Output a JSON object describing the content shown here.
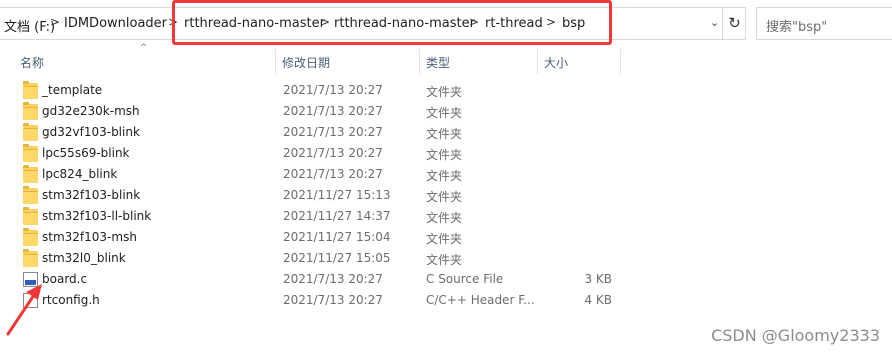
{
  "address": {
    "crumbs": [
      "文档 (F:)",
      "IDMDownloader",
      "rtthread-nano-master",
      "rtthread-nano-master",
      "rt-thread",
      "bsp"
    ],
    "separator": ">"
  },
  "search": {
    "placeholder": "搜索\"bsp\""
  },
  "columns": {
    "name": "名称",
    "date": "修改日期",
    "type": "类型",
    "size": "大小"
  },
  "files": [
    {
      "name": "_template",
      "date": "2021/7/13 20:27",
      "type": "文件夹",
      "size": "",
      "icon": "folder-icon"
    },
    {
      "name": "gd32e230k-msh",
      "date": "2021/7/13 20:27",
      "type": "文件夹",
      "size": "",
      "icon": "folder-icon"
    },
    {
      "name": "gd32vf103-blink",
      "date": "2021/7/13 20:27",
      "type": "文件夹",
      "size": "",
      "icon": "folder-icon"
    },
    {
      "name": "lpc55s69-blink",
      "date": "2021/7/13 20:27",
      "type": "文件夹",
      "size": "",
      "icon": "folder-icon"
    },
    {
      "name": "lpc824_blink",
      "date": "2021/7/13 20:27",
      "type": "文件夹",
      "size": "",
      "icon": "folder-icon"
    },
    {
      "name": "stm32f103-blink",
      "date": "2021/11/27 15:13",
      "type": "文件夹",
      "size": "",
      "icon": "folder-icon"
    },
    {
      "name": "stm32f103-ll-blink",
      "date": "2021/11/27 14:37",
      "type": "文件夹",
      "size": "",
      "icon": "folder-icon"
    },
    {
      "name": "stm32f103-msh",
      "date": "2021/11/27 15:04",
      "type": "文件夹",
      "size": "",
      "icon": "folder-icon"
    },
    {
      "name": "stm32l0_blink",
      "date": "2021/11/27 15:05",
      "type": "文件夹",
      "size": "",
      "icon": "folder-icon"
    },
    {
      "name": "board.c",
      "date": "2021/7/13 20:27",
      "type": "C Source File",
      "size": "3 KB",
      "icon": "c-file-icon"
    },
    {
      "name": "rtconfig.h",
      "date": "2021/7/13 20:27",
      "type": "C/C++ Header F...",
      "size": "4 KB",
      "icon": "h-file-icon"
    }
  ],
  "watermark": "CSDN @Gloomy2333",
  "colors": {
    "highlight": "#f03838",
    "arrow": "#f03838",
    "folder": "#ffd25f"
  }
}
